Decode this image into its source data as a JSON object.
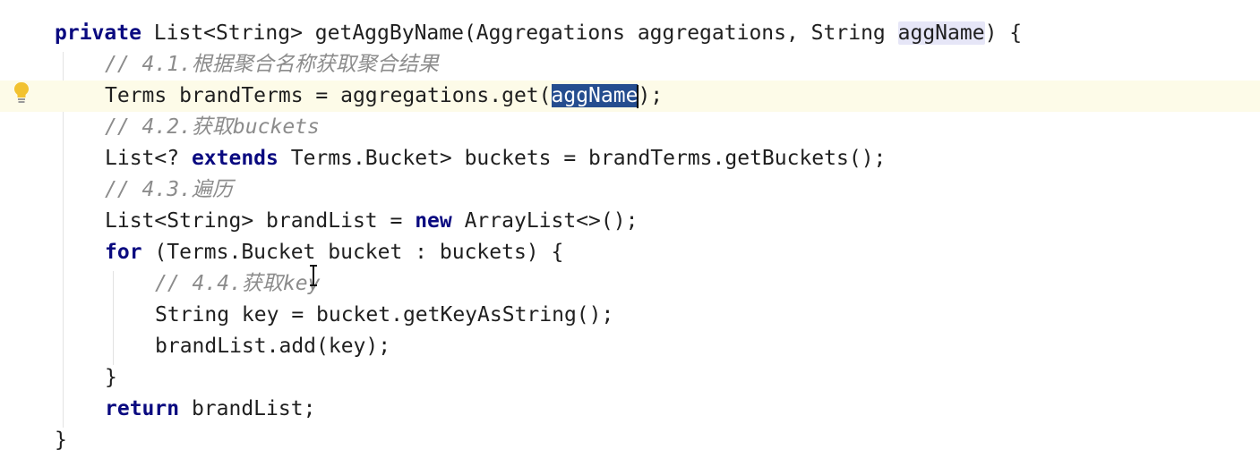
{
  "editor": {
    "colors": {
      "keyword": "#0a0a80",
      "comment": "#8c8c8c",
      "selection": "#254d8f",
      "parameter_highlight": "#e6e6f7",
      "current_line": "#fdfbe8"
    },
    "gutter_icon": "lightbulb-icon",
    "cursor_icon": "text-ibeam-cursor-icon",
    "lines": {
      "l1": {
        "kw_private": "private",
        "t1": " List<String> getAggByName(Aggregations aggregations, String ",
        "param": "aggName",
        "t2": ") {"
      },
      "l2": {
        "comment": "// 4.1.根据聚合名称获取聚合结果"
      },
      "l3": {
        "t1": "Terms brandTerms = aggregations.get(",
        "selected": "aggName",
        "t2": ");"
      },
      "l4": {
        "comment": "// 4.2.获取buckets"
      },
      "l5": {
        "t1": "List<? ",
        "kw_extends": "extends",
        "t2": " Terms.Bucket> buckets = brandTerms.getBuckets();"
      },
      "l6": {
        "comment": "// 4.3.遍历"
      },
      "l7": {
        "t1": "List<String> brandList = ",
        "kw_new": "new",
        "t2": " ArrayList<>();"
      },
      "l8": {
        "kw_for": "for",
        "t1": " (Terms.Bucket bucket : buckets) {"
      },
      "l9": {
        "comment": "// 4.4.获取key"
      },
      "l10": {
        "t1": "String key = bucket.getKeyAsString();"
      },
      "l11": {
        "t1": "brandList.add(key);"
      },
      "l12": {
        "t1": "}"
      },
      "l13": {
        "kw_return": "return",
        "t1": " brandList;"
      },
      "l14": {
        "t1": "}"
      }
    }
  }
}
